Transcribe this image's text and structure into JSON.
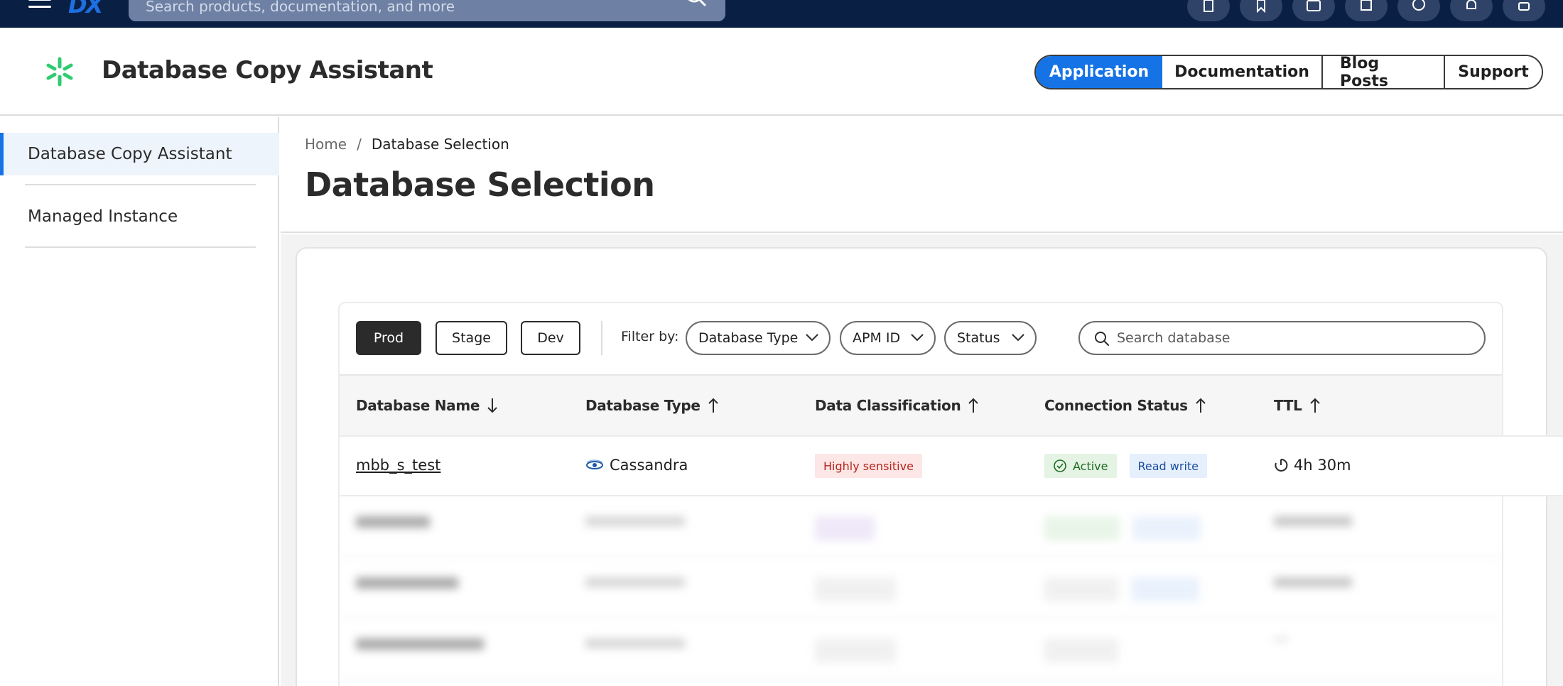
{
  "topbar": {
    "logo": "DX",
    "search_placeholder": "Search products, documentation, and more",
    "icons": [
      "building-icon",
      "bookmark-icon",
      "id-card-icon",
      "certificate-icon",
      "help-icon",
      "bell-icon",
      "user-icon"
    ]
  },
  "header": {
    "app_title": "Database Copy Assistant",
    "tabs": [
      {
        "label": "Application",
        "active": true
      },
      {
        "label": "Documentation",
        "active": false
      },
      {
        "label": "Blog Posts",
        "active": false
      },
      {
        "label": "Support",
        "active": false
      }
    ]
  },
  "sidebar": {
    "items": [
      {
        "label": "Database Copy Assistant",
        "active": true
      },
      {
        "label": "Managed Instance",
        "active": false
      }
    ]
  },
  "breadcrumb": {
    "home": "Home",
    "separator": "/",
    "current": "Database Selection"
  },
  "page_title": "Database Selection",
  "toolbar": {
    "environments": [
      "Prod",
      "Stage",
      "Dev"
    ],
    "active_environment": "Prod",
    "filter_label": "Filter by:",
    "filters": [
      "Database Type",
      "APM ID",
      "Status"
    ],
    "search_placeholder": "Search database"
  },
  "table": {
    "columns": [
      {
        "label": "Database Name",
        "sort": "desc"
      },
      {
        "label": "Database Type",
        "sort": "asc"
      },
      {
        "label": "Data Classification",
        "sort": "asc"
      },
      {
        "label": "Connection Status",
        "sort": "asc"
      },
      {
        "label": "TTL",
        "sort": "asc"
      }
    ],
    "rows": [
      {
        "name": "mbb_s_test",
        "type": "Cassandra",
        "classification": "Highly sensitive",
        "status": "Active",
        "access": "Read write",
        "ttl": "4h 30m"
      }
    ]
  },
  "colors": {
    "topbar": "#0a1f44",
    "accent": "#1573e6",
    "logo_green": "#2ecc71"
  }
}
